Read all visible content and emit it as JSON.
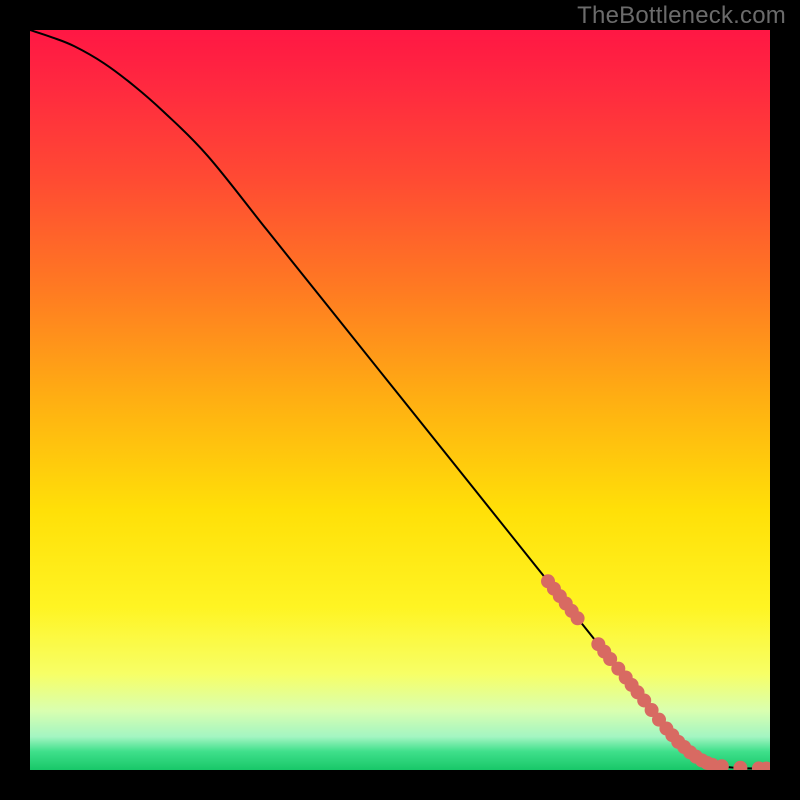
{
  "watermark": "TheBottleneck.com",
  "chart_data": {
    "type": "line",
    "title": "",
    "xlabel": "",
    "ylabel": "",
    "xlim": [
      0,
      100
    ],
    "ylim": [
      0,
      100
    ],
    "background_gradient": {
      "stops": [
        {
          "offset": 0.0,
          "color": "#ff1744"
        },
        {
          "offset": 0.08,
          "color": "#ff2a3f"
        },
        {
          "offset": 0.2,
          "color": "#ff4a33"
        },
        {
          "offset": 0.35,
          "color": "#ff7a22"
        },
        {
          "offset": 0.5,
          "color": "#ffaf12"
        },
        {
          "offset": 0.65,
          "color": "#ffe008"
        },
        {
          "offset": 0.78,
          "color": "#fff423"
        },
        {
          "offset": 0.87,
          "color": "#f7ff66"
        },
        {
          "offset": 0.92,
          "color": "#d9ffb0"
        },
        {
          "offset": 0.955,
          "color": "#a3f5c2"
        },
        {
          "offset": 0.975,
          "color": "#3fe08b"
        },
        {
          "offset": 1.0,
          "color": "#18c768"
        }
      ]
    },
    "series": [
      {
        "name": "curve",
        "color": "#000000",
        "x": [
          0,
          3,
          6,
          10,
          14,
          18,
          24,
          32,
          40,
          50,
          60,
          70,
          78,
          84,
          88,
          90.5,
          93,
          96,
          100
        ],
        "y": [
          100,
          99,
          97.8,
          95.5,
          92.5,
          89,
          83,
          73,
          63,
          50.5,
          38,
          25.5,
          15.5,
          8,
          3.4,
          1.4,
          0.6,
          0.25,
          0.2
        ]
      }
    ],
    "points": {
      "name": "highlight-dots",
      "color": "#d86a62",
      "radius": 7,
      "data": [
        {
          "x": 70.0,
          "y": 25.5
        },
        {
          "x": 70.8,
          "y": 24.5
        },
        {
          "x": 71.6,
          "y": 23.5
        },
        {
          "x": 72.4,
          "y": 22.5
        },
        {
          "x": 73.2,
          "y": 21.5
        },
        {
          "x": 74.0,
          "y": 20.5
        },
        {
          "x": 76.8,
          "y": 17.0
        },
        {
          "x": 77.6,
          "y": 16.0
        },
        {
          "x": 78.4,
          "y": 15.0
        },
        {
          "x": 79.5,
          "y": 13.7
        },
        {
          "x": 80.5,
          "y": 12.5
        },
        {
          "x": 81.3,
          "y": 11.5
        },
        {
          "x": 82.1,
          "y": 10.5
        },
        {
          "x": 83.0,
          "y": 9.4
        },
        {
          "x": 84.0,
          "y": 8.1
        },
        {
          "x": 85.0,
          "y": 6.8
        },
        {
          "x": 86.0,
          "y": 5.6
        },
        {
          "x": 86.8,
          "y": 4.7
        },
        {
          "x": 87.6,
          "y": 3.8
        },
        {
          "x": 88.4,
          "y": 3.1
        },
        {
          "x": 89.2,
          "y": 2.4
        },
        {
          "x": 90.0,
          "y": 1.8
        },
        {
          "x": 90.8,
          "y": 1.3
        },
        {
          "x": 91.5,
          "y": 0.95
        },
        {
          "x": 92.2,
          "y": 0.7
        },
        {
          "x": 93.5,
          "y": 0.5
        },
        {
          "x": 96.0,
          "y": 0.3
        },
        {
          "x": 98.5,
          "y": 0.22
        },
        {
          "x": 99.5,
          "y": 0.2
        }
      ]
    }
  }
}
